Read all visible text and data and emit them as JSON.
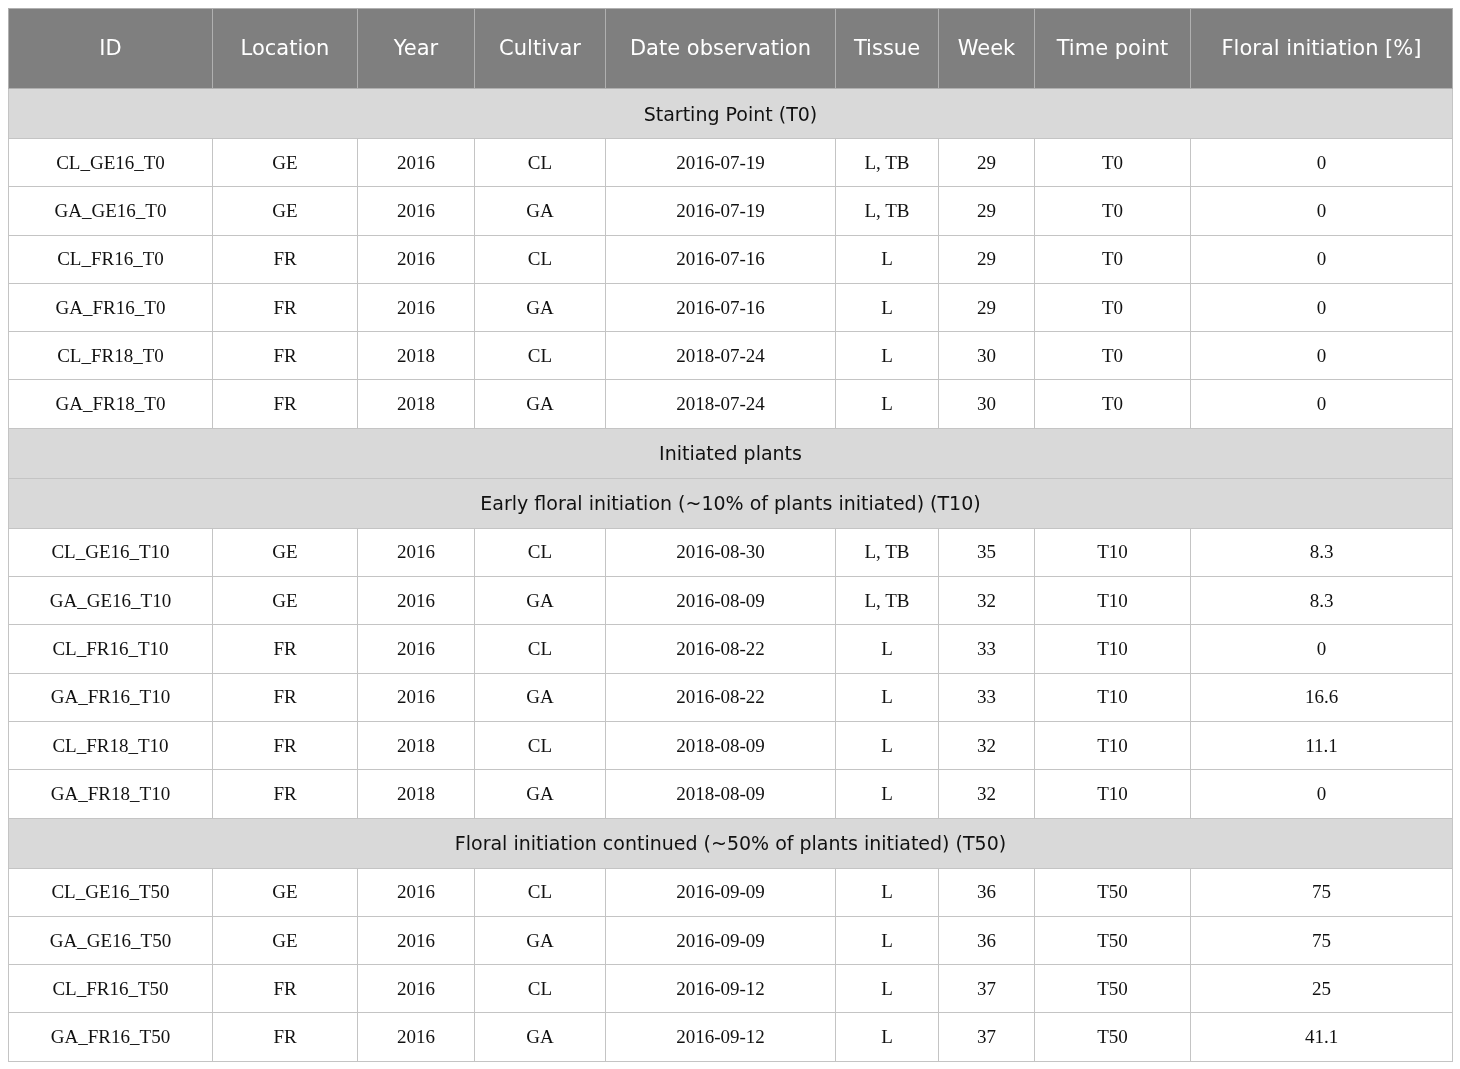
{
  "table": {
    "columns": [
      "ID",
      "Location",
      "Year",
      "Cultivar",
      "Date observation",
      "Tissue",
      "Week",
      "Time point",
      "Floral initiation [%]"
    ],
    "groups": [
      {
        "title": "Starting Point (T0)",
        "rows": [
          [
            "CL_GE16_T0",
            "GE",
            "2016",
            "CL",
            "2016-07-19",
            "L, TB",
            "29",
            "T0",
            "0"
          ],
          [
            "GA_GE16_T0",
            "GE",
            "2016",
            "GA",
            "2016-07-19",
            "L, TB",
            "29",
            "T0",
            "0"
          ],
          [
            "CL_FR16_T0",
            "FR",
            "2016",
            "CL",
            "2016-07-16",
            "L",
            "29",
            "T0",
            "0"
          ],
          [
            "GA_FR16_T0",
            "FR",
            "2016",
            "GA",
            "2016-07-16",
            "L",
            "29",
            "T0",
            "0"
          ],
          [
            "CL_FR18_T0",
            "FR",
            "2018",
            "CL",
            "2018-07-24",
            "L",
            "30",
            "T0",
            "0"
          ],
          [
            "GA_FR18_T0",
            "FR",
            "2018",
            "GA",
            "2018-07-24",
            "L",
            "30",
            "T0",
            "0"
          ]
        ]
      },
      {
        "title": "Initiated plants"
      },
      {
        "title": "Early floral initiation (~10% of plants initiated) (T10)",
        "rows": [
          [
            "CL_GE16_T10",
            "GE",
            "2016",
            "CL",
            "2016-08-30",
            "L, TB",
            "35",
            "T10",
            "8.3"
          ],
          [
            "GA_GE16_T10",
            "GE",
            "2016",
            "GA",
            "2016-08-09",
            "L, TB",
            "32",
            "T10",
            "8.3"
          ],
          [
            "CL_FR16_T10",
            "FR",
            "2016",
            "CL",
            "2016-08-22",
            "L",
            "33",
            "T10",
            "0"
          ],
          [
            "GA_FR16_T10",
            "FR",
            "2016",
            "GA",
            "2016-08-22",
            "L",
            "33",
            "T10",
            "16.6"
          ],
          [
            "CL_FR18_T10",
            "FR",
            "2018",
            "CL",
            "2018-08-09",
            "L",
            "32",
            "T10",
            "11.1"
          ],
          [
            "GA_FR18_T10",
            "FR",
            "2018",
            "GA",
            "2018-08-09",
            "L",
            "32",
            "T10",
            "0"
          ]
        ]
      },
      {
        "title": "Floral initiation continued (~50% of plants initiated) (T50)",
        "rows": [
          [
            "CL_GE16_T50",
            "GE",
            "2016",
            "CL",
            "2016-09-09",
            "L",
            "36",
            "T50",
            "75"
          ],
          [
            "GA_GE16_T50",
            "GE",
            "2016",
            "GA",
            "2016-09-09",
            "L",
            "36",
            "T50",
            "75"
          ],
          [
            "CL_FR16_T50",
            "FR",
            "2016",
            "CL",
            "2016-09-12",
            "L",
            "37",
            "T50",
            "25"
          ],
          [
            "GA_FR16_T50",
            "FR",
            "2016",
            "GA",
            "2016-09-12",
            "L",
            "37",
            "T50",
            "41.1"
          ]
        ]
      }
    ]
  }
}
